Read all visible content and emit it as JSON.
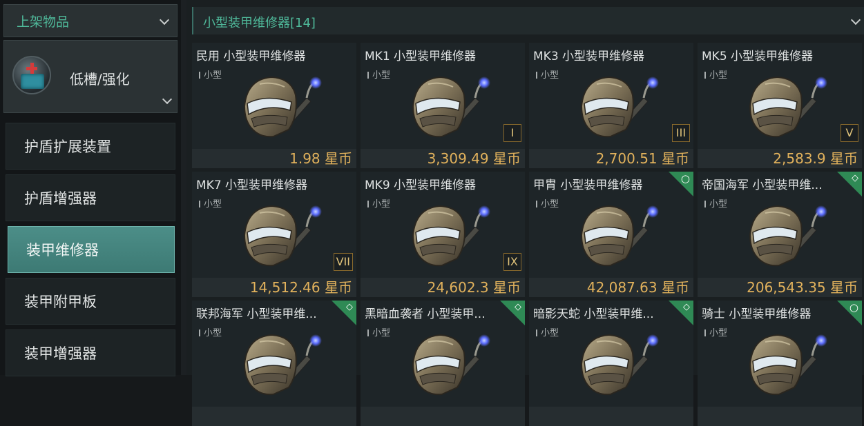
{
  "sidebar": {
    "dropdown_label": "上架物品",
    "category": {
      "label": "低槽/强化",
      "icon": "armor-repair-category-icon"
    },
    "items": [
      {
        "label": "护盾扩展装置",
        "active": false
      },
      {
        "label": "护盾增强器",
        "active": false
      },
      {
        "label": "装甲维修器",
        "active": true
      },
      {
        "label": "装甲附甲板",
        "active": false
      },
      {
        "label": "装甲增强器",
        "active": false
      }
    ]
  },
  "content": {
    "header_title": "小型装甲维修器[14]",
    "cards": [
      {
        "name": "民用 小型装甲维修器",
        "size": "小型",
        "tier": "",
        "badge": "",
        "price": "1.98 星币"
      },
      {
        "name": "MK1 小型装甲维修器",
        "size": "小型",
        "tier": "I",
        "badge": "",
        "price": "3,309.49 星币"
      },
      {
        "name": "MK3 小型装甲维修器",
        "size": "小型",
        "tier": "III",
        "badge": "",
        "price": "2,700.51 星币"
      },
      {
        "name": "MK5 小型装甲维修器",
        "size": "小型",
        "tier": "V",
        "badge": "",
        "price": "2,583.9 星币"
      },
      {
        "name": "MK7 小型装甲维修器",
        "size": "小型",
        "tier": "VII",
        "badge": "",
        "price": "14,512.46 星币"
      },
      {
        "name": "MK9 小型装甲维修器",
        "size": "小型",
        "tier": "IX",
        "badge": "",
        "price": "24,602.3 星币"
      },
      {
        "name": "甲胄 小型装甲维修器",
        "size": "小型",
        "tier": "",
        "badge": "circle",
        "price": "42,087.63 星币"
      },
      {
        "name": "帝国海军 小型装甲维...",
        "size": "小型",
        "tier": "",
        "badge": "diamond",
        "price": "206,543.35 星币"
      },
      {
        "name": "联邦海军 小型装甲维...",
        "size": "小型",
        "tier": "",
        "badge": "diamond",
        "price": ""
      },
      {
        "name": "黑暗血袭者 小型装甲...",
        "size": "小型",
        "tier": "",
        "badge": "diamond",
        "price": ""
      },
      {
        "name": "暗影天蛇 小型装甲维...",
        "size": "小型",
        "tier": "",
        "badge": "diamond",
        "price": ""
      },
      {
        "name": "骑士 小型装甲维修器",
        "size": "小型",
        "tier": "",
        "badge": "circle",
        "price": ""
      }
    ]
  },
  "colors": {
    "accent_green": "#4fb99a",
    "price_gold": "#e2b25c",
    "active_teal": "#4c8e88",
    "badge_green": "#2f8a55"
  }
}
